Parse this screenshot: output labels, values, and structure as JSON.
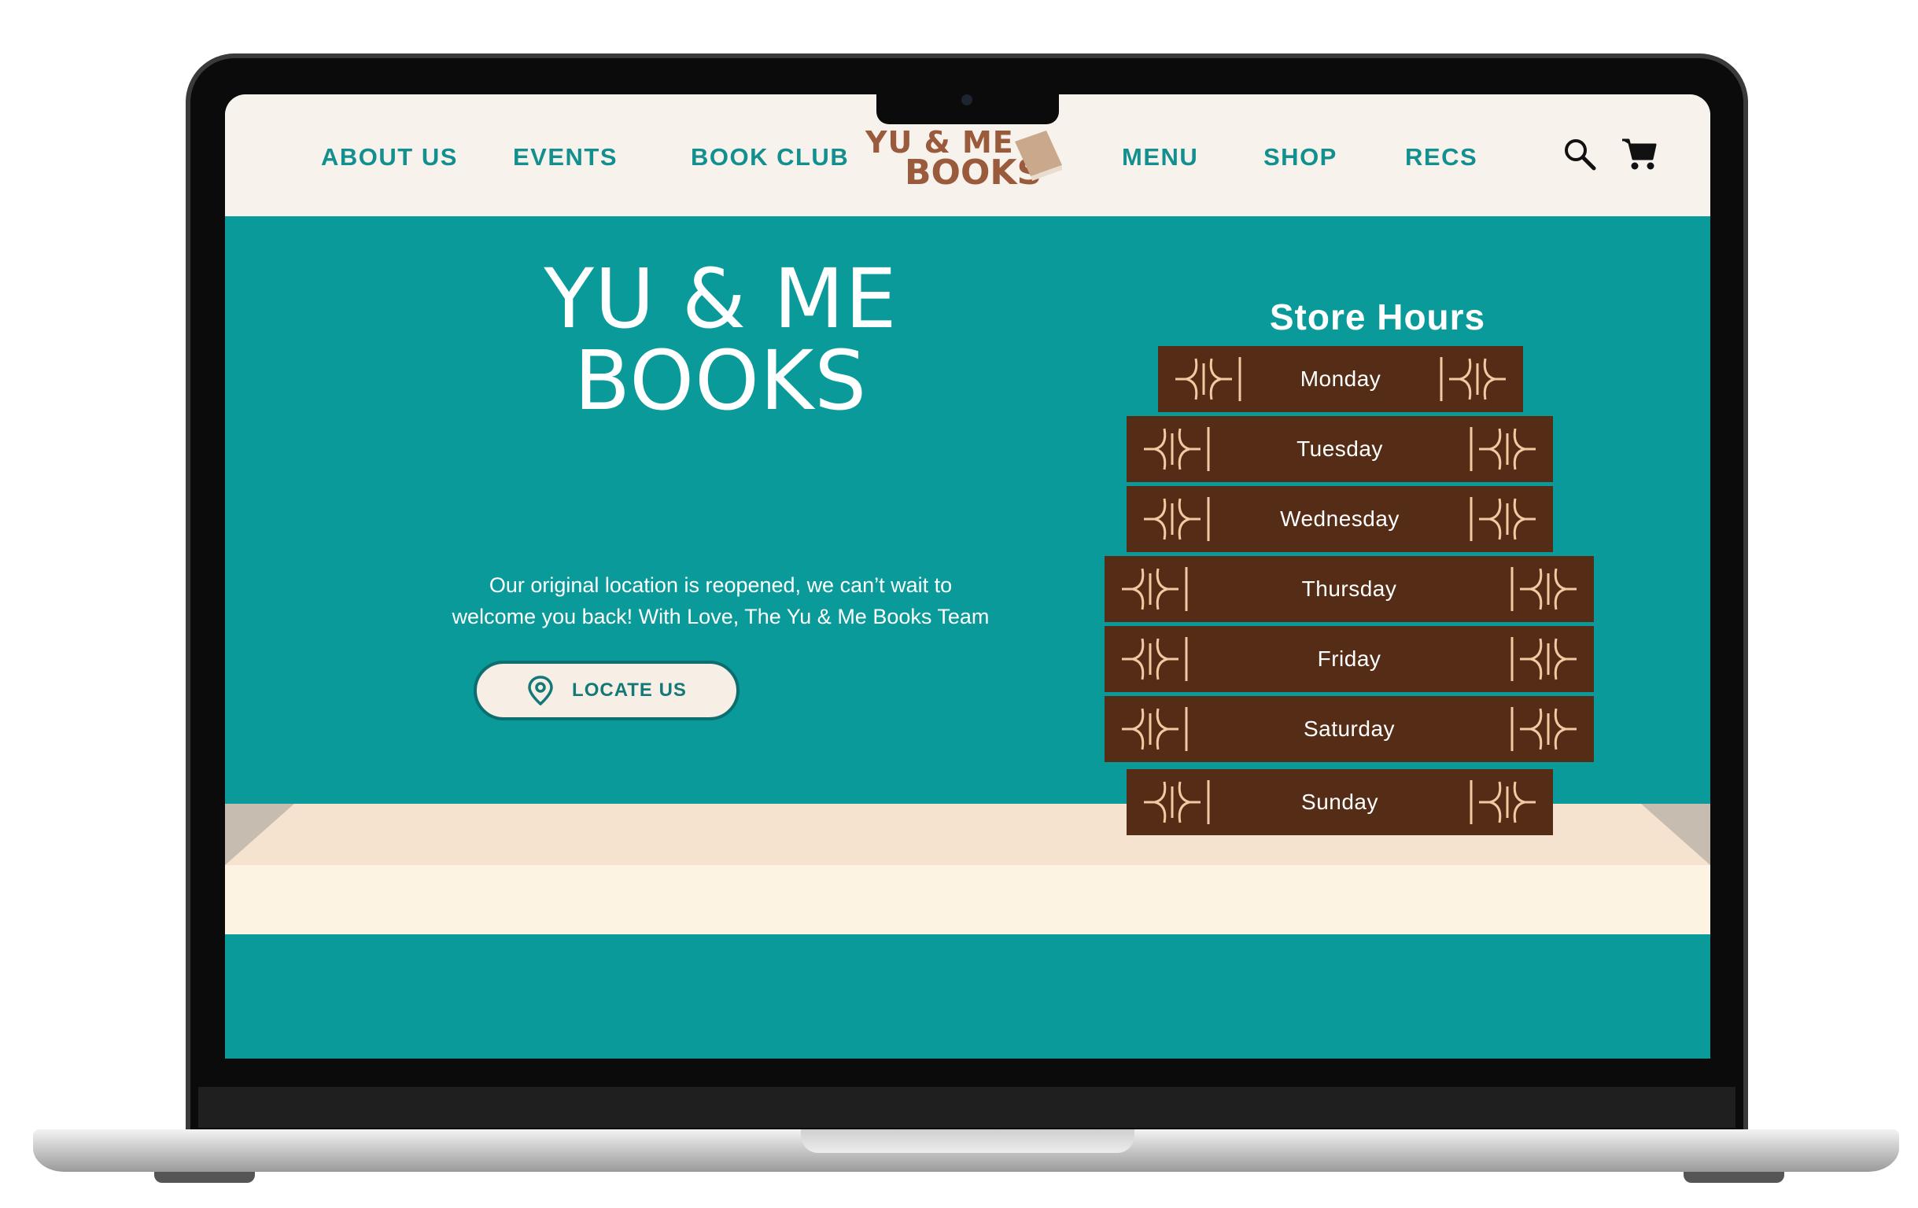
{
  "nav": {
    "links_left": [
      "ABOUT US",
      "EVENTS",
      "BOOK CLUB"
    ],
    "links_right": [
      "MENU",
      "SHOP",
      "RECS"
    ],
    "logo": {
      "line1": "YU & ME",
      "line2": "BOOKS"
    },
    "icons": [
      "search-icon",
      "cart-icon"
    ]
  },
  "hero": {
    "title_line1": "YU & ME",
    "title_line2": "BOOKS",
    "subtitle_line1": "Our original location is reopened, we can’t wait to",
    "subtitle_line2": "welcome you back! With Love, The Yu & Me Books Team",
    "button_label": "LOCATE US",
    "button_icon": "location-pin-icon"
  },
  "store_hours": {
    "title": "Store Hours",
    "days": [
      "Monday",
      "Tuesday",
      "Wednesday",
      "Thursday",
      "Friday",
      "Saturday",
      "Sunday"
    ]
  },
  "colors": {
    "teal": "#0a9a9a",
    "nav_bg": "#f7f2ec",
    "nav_text": "#128f8f",
    "book_brown": "#552c15",
    "ornament": "#f3c9a3",
    "logo_brown": "#9a5a3c",
    "shelf_top": "#f6e3cf",
    "shelf_front": "#fdf3e2"
  }
}
